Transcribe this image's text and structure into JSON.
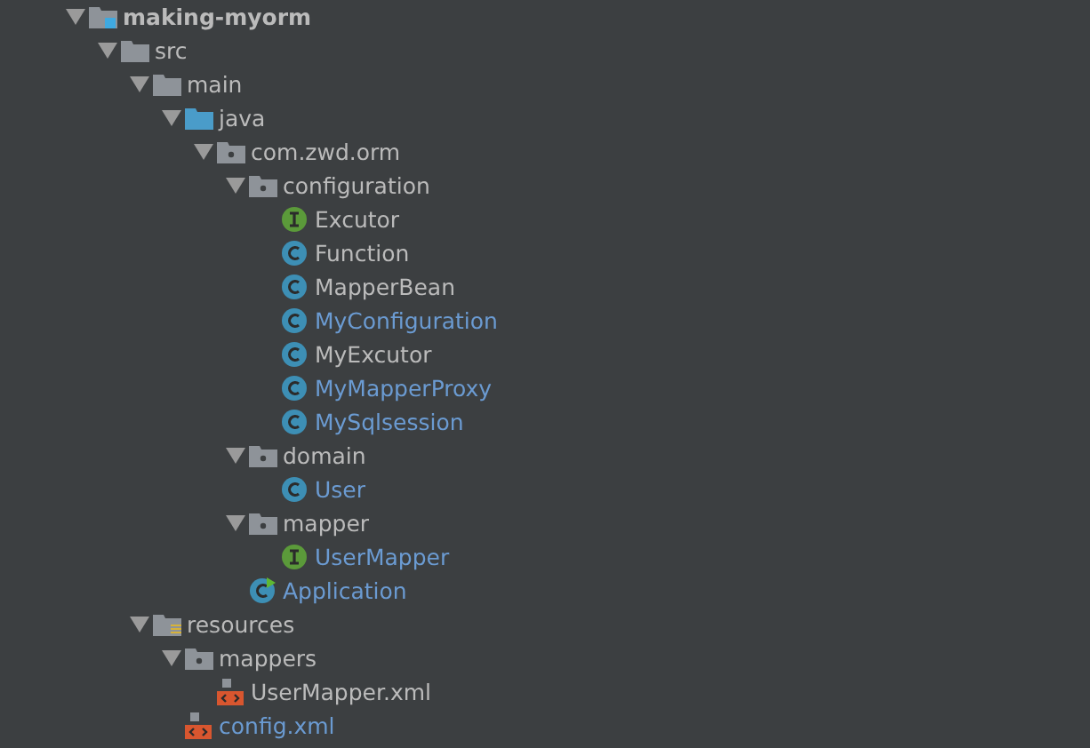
{
  "project_tree": [
    {
      "label": "making-myorm",
      "kind": "module",
      "modified": false,
      "expanded": true,
      "children": [
        {
          "label": "src",
          "kind": "folder",
          "modified": false,
          "expanded": true,
          "children": [
            {
              "label": "main",
              "kind": "folder",
              "modified": false,
              "expanded": true,
              "children": [
                {
                  "label": "java",
                  "kind": "source",
                  "modified": false,
                  "expanded": true,
                  "children": [
                    {
                      "label": "com.zwd.orm",
                      "kind": "package",
                      "modified": false,
                      "expanded": true,
                      "children": [
                        {
                          "label": "configuration",
                          "kind": "package",
                          "modified": false,
                          "expanded": true,
                          "children": [
                            {
                              "label": "Excutor",
                              "kind": "interface",
                              "modified": false
                            },
                            {
                              "label": "Function",
                              "kind": "class",
                              "modified": false
                            },
                            {
                              "label": "MapperBean",
                              "kind": "class",
                              "modified": false
                            },
                            {
                              "label": "MyConfiguration",
                              "kind": "class",
                              "modified": true
                            },
                            {
                              "label": "MyExcutor",
                              "kind": "class",
                              "modified": false
                            },
                            {
                              "label": "MyMapperProxy",
                              "kind": "class",
                              "modified": true
                            },
                            {
                              "label": "MySqlsession",
                              "kind": "class",
                              "modified": true
                            }
                          ]
                        },
                        {
                          "label": "domain",
                          "kind": "package",
                          "modified": false,
                          "expanded": true,
                          "children": [
                            {
                              "label": "User",
                              "kind": "class",
                              "modified": true
                            }
                          ]
                        },
                        {
                          "label": "mapper",
                          "kind": "package",
                          "modified": false,
                          "expanded": true,
                          "children": [
                            {
                              "label": "UserMapper",
                              "kind": "interface",
                              "modified": true
                            }
                          ]
                        },
                        {
                          "label": "Application",
                          "kind": "app",
                          "modified": true
                        }
                      ]
                    }
                  ]
                }
              ]
            },
            {
              "label": "resources",
              "kind": "resources",
              "modified": false,
              "expanded": true,
              "children": [
                {
                  "label": "mappers",
                  "kind": "package",
                  "modified": false,
                  "expanded": true,
                  "children": [
                    {
                      "label": "UserMapper.xml",
                      "kind": "xml",
                      "modified": false
                    }
                  ]
                },
                {
                  "label": "config.xml",
                  "kind": "xml",
                  "modified": true
                }
              ]
            }
          ]
        }
      ]
    }
  ]
}
